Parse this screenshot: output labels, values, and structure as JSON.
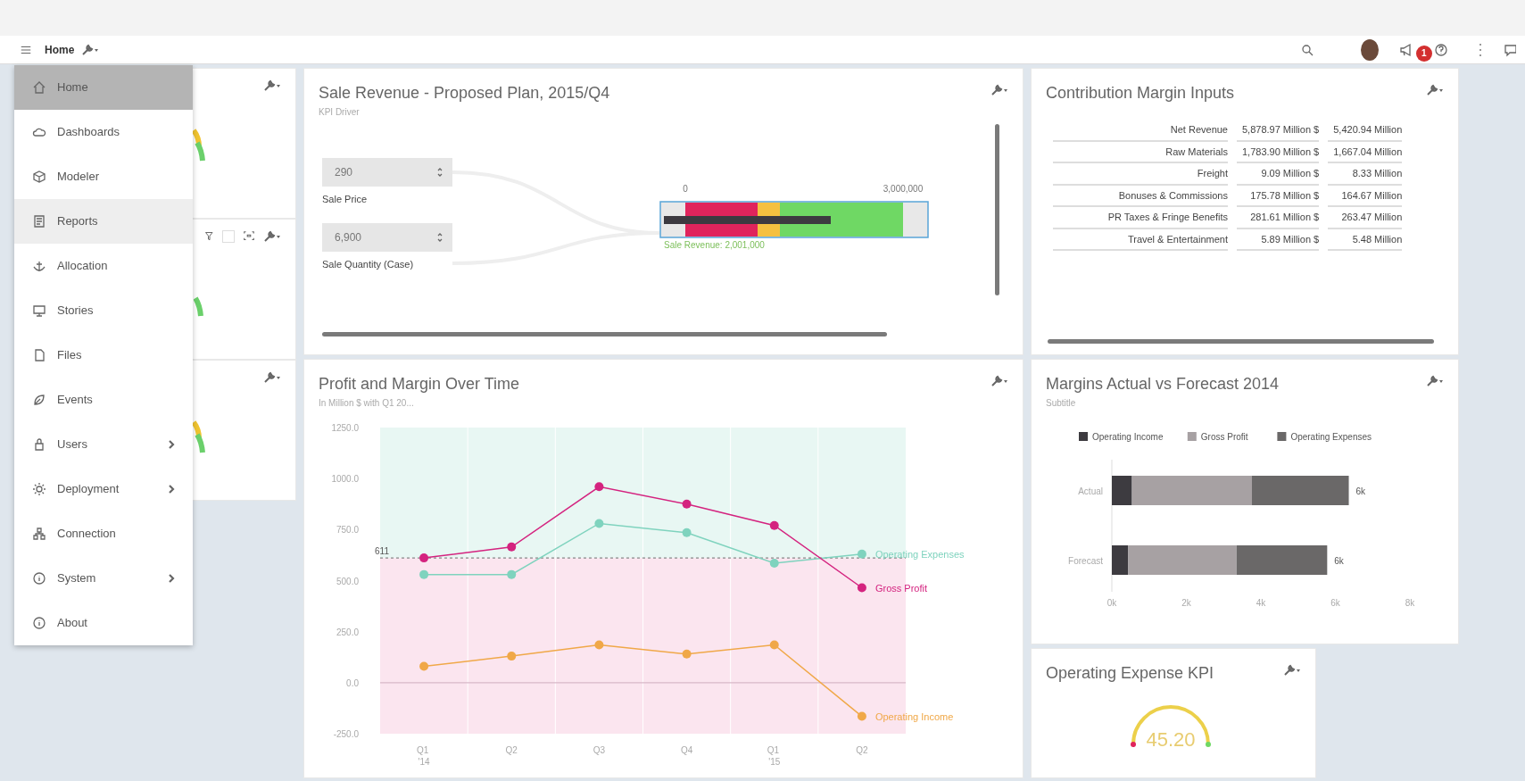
{
  "top_bar": {
    "title": "Home",
    "notification_count": "1"
  },
  "nav_menu": [
    {
      "label": "Home",
      "selected": true,
      "hovered": false,
      "submenu": false
    },
    {
      "label": "Dashboards",
      "selected": false,
      "hovered": false,
      "submenu": false
    },
    {
      "label": "Modeler",
      "selected": false,
      "hovered": false,
      "submenu": false
    },
    {
      "label": "Reports",
      "selected": false,
      "hovered": true,
      "submenu": false
    },
    {
      "label": "Allocation",
      "selected": false,
      "hovered": false,
      "submenu": false
    },
    {
      "label": "Stories",
      "selected": false,
      "hovered": false,
      "submenu": false
    },
    {
      "label": "Files",
      "selected": false,
      "hovered": false,
      "submenu": false
    },
    {
      "label": "Events",
      "selected": false,
      "hovered": false,
      "submenu": false
    },
    {
      "label": "Users",
      "selected": false,
      "hovered": false,
      "submenu": true
    },
    {
      "label": "Deployment",
      "selected": false,
      "hovered": false,
      "submenu": true
    },
    {
      "label": "Connection",
      "selected": false,
      "hovered": false,
      "submenu": false
    },
    {
      "label": "System",
      "selected": false,
      "hovered": false,
      "submenu": true
    },
    {
      "label": "About",
      "selected": false,
      "hovered": false,
      "submenu": false
    }
  ],
  "sale_revenue": {
    "title": "Sale Revenue - Proposed Plan, 2015/Q4",
    "subtitle": "KPI Driver",
    "inputs": [
      {
        "value": "290",
        "label": "Sale Price"
      },
      {
        "value": "6,900",
        "label": "Sale Quantity (Case)"
      }
    ],
    "scale_labels": [
      "0",
      "3,000,000"
    ],
    "caption": "Sale Revenue: 2,001,000"
  },
  "left_panel_toolbar": {
    "checked": false
  },
  "contribution_margin": {
    "title": "Contribution Margin Inputs",
    "rows": [
      [
        "Net Revenue",
        "5,878.97 Million $",
        "5,420.94 Million"
      ],
      [
        "Raw Materials",
        "1,783.90 Million $",
        "1,667.04 Million"
      ],
      [
        "Freight",
        "9.09 Million $",
        "8.33 Million"
      ],
      [
        "Bonuses & Commissions",
        "175.78 Million $",
        "164.67 Million"
      ],
      [
        "PR Taxes & Fringe Benefits",
        "281.61 Million $",
        "263.47 Million"
      ],
      [
        "Travel & Entertainment",
        "5.89 Million $",
        "5.48 Million"
      ]
    ]
  },
  "profit_margin": {
    "title": "Profit and Margin Over Time",
    "subtitle": "In Million $ with Q1 20...",
    "chart_data": {
      "type": "line",
      "categories": [
        "Q1 '14",
        "Q2",
        "Q3",
        "Q4",
        "Q1 '15",
        "Q2"
      ],
      "ylim": [
        -250,
        1250
      ],
      "yticks": [
        {
          "value": -250,
          "label": "-250.0"
        },
        {
          "value": 0,
          "label": "0.0"
        },
        {
          "value": 250,
          "label": "250.0"
        },
        {
          "value": 500,
          "label": "500.0"
        },
        {
          "value": 750,
          "label": "750.0"
        },
        {
          "value": 1000,
          "label": "1000.0"
        },
        {
          "value": 1250,
          "label": "1250.0"
        }
      ],
      "series": [
        {
          "name": "Operating Expenses",
          "color": "#7fd3be",
          "marker": "circle",
          "values": [
            530,
            530,
            780,
            735,
            585,
            630
          ]
        },
        {
          "name": "Gross Profit",
          "color": "#d4237f",
          "marker": "circle",
          "values": [
            611,
            665,
            960,
            875,
            770,
            465
          ]
        },
        {
          "name": "Operating Income",
          "color": "#f0a848",
          "marker": "circle",
          "values": [
            80,
            130,
            185,
            140,
            185,
            -165
          ]
        }
      ],
      "ref_lines": [
        {
          "axis": "y",
          "value": 611,
          "label": "611"
        }
      ],
      "bands": [
        {
          "axis": "y",
          "from": 611,
          "to": 1250,
          "color": "#e8f7f3"
        },
        {
          "axis": "y",
          "from": -250,
          "to": 611,
          "color": "#fbe5ef"
        }
      ]
    }
  },
  "margins": {
    "title": "Margins Actual vs Forecast 2014",
    "subtitle": "Subtitle",
    "chart_data": {
      "type": "bar",
      "orientation": "horizontal",
      "stacked": true,
      "categories": [
        "Actual",
        "Forecast"
      ],
      "xlim": [
        0,
        8000
      ],
      "legend": true,
      "xticks": [
        {
          "value": 0,
          "label": "0k"
        },
        {
          "value": 2000,
          "label": "2k"
        },
        {
          "value": 4000,
          "label": "4k"
        },
        {
          "value": 6000,
          "label": "6k"
        },
        {
          "value": 8000,
          "label": "8k"
        }
      ],
      "series": [
        {
          "name": "Operating Income",
          "color": "#3d3b40",
          "values": [
            540,
            440
          ]
        },
        {
          "name": "Gross Profit",
          "color": "#a7a1a3",
          "values": [
            3220,
            2910
          ]
        },
        {
          "name": "Operating Expenses",
          "color": "#6a6868",
          "values": [
            2600,
            2430
          ]
        }
      ],
      "value_labels": [
        "6k",
        "6k"
      ]
    }
  },
  "operating_expense_kpi": {
    "title": "Operating Expense KPI",
    "value": "45.20"
  }
}
